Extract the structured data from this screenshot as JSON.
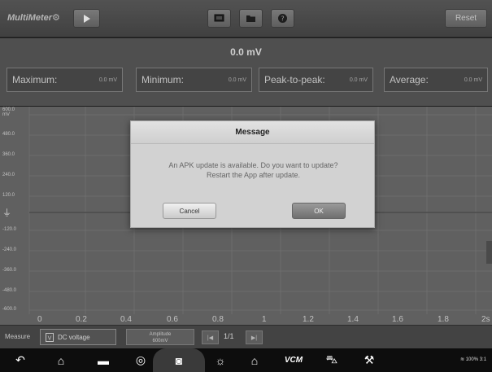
{
  "app": {
    "title": "MultiMeter"
  },
  "toolbar": {
    "reset_label": "Reset"
  },
  "readout": {
    "main_value": "0.0 mV",
    "stats": [
      {
        "label": "Maximum:",
        "value": "0.0 mV"
      },
      {
        "label": "Minimum:",
        "value": "0.0 mV"
      },
      {
        "label": "Peak-to-peak:",
        "value": "0.0 mV"
      },
      {
        "label": "Average:",
        "value": "0.0 mV"
      }
    ]
  },
  "graph": {
    "y_unit": "mV",
    "y_ticks": [
      "600.0",
      "480.0",
      "360.0",
      "240.0",
      "120.0",
      "-120.0",
      "-240.0",
      "-360.0",
      "-480.0",
      "-600.0"
    ],
    "x_ticks": [
      "0",
      "0.2",
      "0.4",
      "0.6",
      "0.8",
      "1",
      "1.2",
      "1.4",
      "1.6",
      "1.8",
      "2s"
    ]
  },
  "controls": {
    "measure_label": "Measure",
    "measure_value": "DC voltage",
    "amplitude_label": "Amplitude",
    "amplitude_value": "600mV",
    "page_text": "1/1"
  },
  "dialog": {
    "title": "Message",
    "line1": "An APK update is available. Do you want to update?",
    "line2": "Restart the App after update.",
    "cancel_label": "Cancel",
    "ok_label": "OK"
  },
  "navbar": {
    "vcm_label": "VCM",
    "status_text": "100% 3:1"
  }
}
